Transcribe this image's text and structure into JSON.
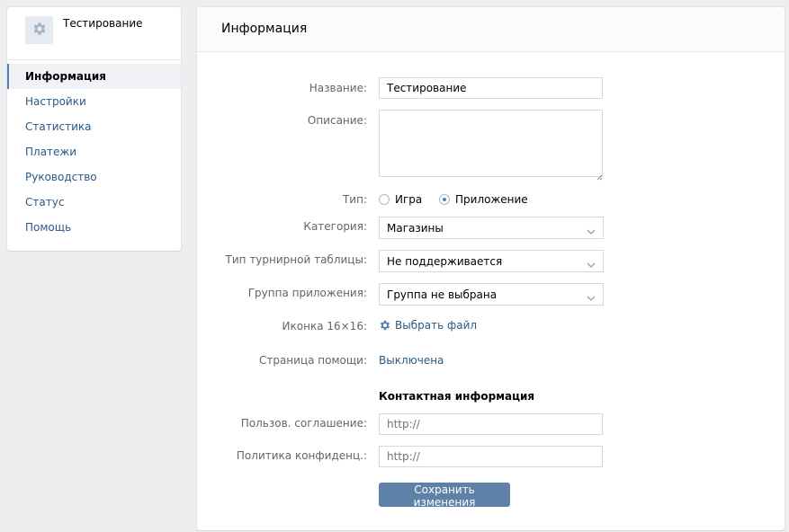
{
  "sidebar": {
    "app_name": "Тестирование",
    "items": [
      {
        "label": "Информация"
      },
      {
        "label": "Настройки"
      },
      {
        "label": "Статистика"
      },
      {
        "label": "Платежи"
      },
      {
        "label": "Руководство"
      },
      {
        "label": "Статус"
      },
      {
        "label": "Помощь"
      }
    ]
  },
  "main": {
    "title": "Информация",
    "name": {
      "label": "Название:",
      "value": "Тестирование"
    },
    "description": {
      "label": "Описание:",
      "value": ""
    },
    "type": {
      "label": "Тип:",
      "options": [
        {
          "label": "Игра",
          "checked": false
        },
        {
          "label": "Приложение",
          "checked": true
        }
      ]
    },
    "category": {
      "label": "Категория:",
      "value": "Магазины"
    },
    "leaderboard": {
      "label": "Тип турнирной таблицы:",
      "value": "Не поддерживается"
    },
    "app_group": {
      "label": "Группа приложения:",
      "value": "Группа не выбрана"
    },
    "icon16": {
      "label": "Иконка 16×16:",
      "link": "Выбрать файл",
      "icon": "gear-icon"
    },
    "help_page": {
      "label": "Страница помощи:",
      "link": "Выключена"
    },
    "contact_title": "Контактная информация",
    "user_agreement": {
      "label": "Пользов. соглашение:",
      "placeholder": "http://"
    },
    "privacy_policy": {
      "label": "Политика конфиденц.:",
      "placeholder": "http://"
    },
    "save_label": "Сохранить изменения"
  },
  "colors": {
    "accent": "#5181b8",
    "link": "#2a5885",
    "button": "#5e81a8",
    "background": "#edeef0"
  }
}
